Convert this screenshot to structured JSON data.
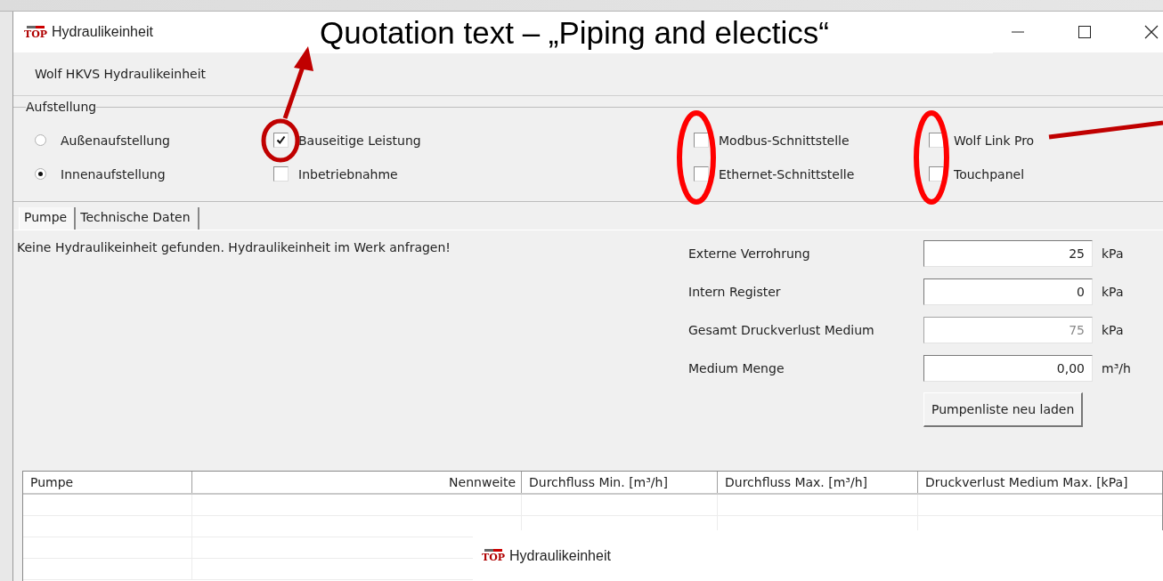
{
  "window": {
    "logo": "TOP",
    "title": "Hydraulikeinheit"
  },
  "header": "Wolf HKVS Hydraulikeinheit",
  "group": {
    "title": "Aufstellung",
    "columns": [
      [
        {
          "kind": "radio",
          "label": "Außenaufstellung",
          "checked": false
        },
        {
          "kind": "radio",
          "label": "Innenaufstellung",
          "checked": true
        }
      ],
      [
        {
          "kind": "checkbox",
          "label": "Bauseitige Leistung",
          "checked": true
        },
        {
          "kind": "checkbox",
          "label": "Inbetriebnahme",
          "checked": false
        }
      ],
      [
        {
          "kind": "checkbox",
          "label": "Modbus-Schnittstelle",
          "checked": false
        },
        {
          "kind": "checkbox",
          "label": "Ethernet-Schnittstelle",
          "checked": false
        }
      ],
      [
        {
          "kind": "checkbox",
          "label": "Wolf Link Pro",
          "checked": false
        },
        {
          "kind": "checkbox",
          "label": "Touchpanel",
          "checked": false
        }
      ]
    ]
  },
  "tabs": [
    {
      "label": "Pumpe",
      "selected": true
    },
    {
      "label": "Technische Daten",
      "selected": false
    }
  ],
  "message": "Keine Hydraulikeinheit gefunden. Hydraulikeinheit im Werk anfragen!",
  "fields": [
    {
      "label": "Externe Verrohrung",
      "value": "25",
      "unit": "kPa",
      "disabled": false
    },
    {
      "label": "Intern Register",
      "value": "0",
      "unit": "kPa",
      "disabled": false
    },
    {
      "label": "Gesamt Druckverlust Medium",
      "value": "75",
      "unit": "kPa",
      "disabled": true
    },
    {
      "label": "Medium Menge",
      "value": "0,00",
      "unit": "m³/h",
      "disabled": false
    }
  ],
  "reload_button": "Pumpenliste neu laden",
  "table": {
    "columns": [
      "Pumpe",
      "Nennweite",
      "Durchfluss Min. [m³/h]",
      "Durchfluss Max. [m³/h]",
      "Druckverlust Medium Max. [kPa]"
    ]
  },
  "popup": {
    "logo": "TOP",
    "title": "Hydraulikeinheit"
  },
  "annotation": {
    "callout": "Quotation text – „Piping and electics“"
  }
}
